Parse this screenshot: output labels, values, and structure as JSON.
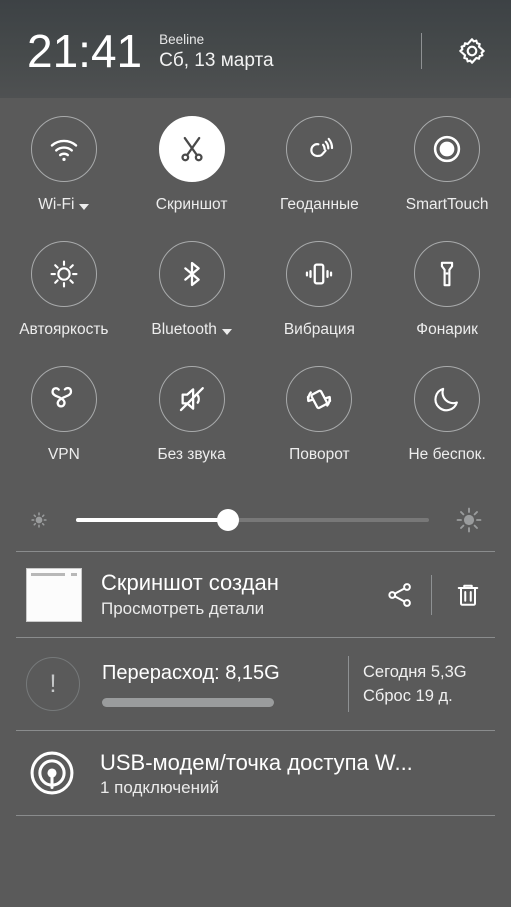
{
  "header": {
    "time": "21:41",
    "carrier": "Beeline",
    "date": "Сб, 13 марта",
    "settings_icon": "gear-icon"
  },
  "tiles": [
    [
      {
        "label": "Wi-Fi",
        "icon": "wifi-icon",
        "active": false,
        "caret": true
      },
      {
        "label": "Скриншот",
        "icon": "scissors-icon",
        "active": true,
        "caret": false
      },
      {
        "label": "Геоданные",
        "icon": "location-touch-icon",
        "active": false,
        "caret": false
      },
      {
        "label": "SmartTouch",
        "icon": "smarttouch-icon",
        "active": false,
        "caret": false
      }
    ],
    [
      {
        "label": "Автояркость",
        "icon": "brightness-auto-icon",
        "active": false,
        "caret": false
      },
      {
        "label": "Bluetooth",
        "icon": "bluetooth-icon",
        "active": false,
        "caret": true
      },
      {
        "label": "Вибрация",
        "icon": "vibration-icon",
        "active": false,
        "caret": false
      },
      {
        "label": "Фонарик",
        "icon": "flashlight-icon",
        "active": false,
        "caret": false
      }
    ],
    [
      {
        "label": "VPN",
        "icon": "vpn-key-icon",
        "active": false,
        "caret": false
      },
      {
        "label": "Без звука",
        "icon": "mute-icon",
        "active": false,
        "caret": false
      },
      {
        "label": "Поворот",
        "icon": "rotate-icon",
        "active": false,
        "caret": false
      },
      {
        "label": "Не беспок.",
        "icon": "moon-icon",
        "active": false,
        "caret": false
      }
    ]
  ],
  "brightness": {
    "value_percent": 43,
    "low_icon": "brightness-low-icon",
    "high_icon": "brightness-high-icon"
  },
  "notifications": {
    "screenshot": {
      "title": "Скриншот создан",
      "subtitle": "Просмотреть детали",
      "thumbnail_icon": "screenshot-thumbnail",
      "share_icon": "share-icon",
      "delete_icon": "trash-icon"
    },
    "data_usage": {
      "icon": "warning-circle-icon",
      "title": "Перерасход: 8,15G",
      "progress_percent": 100,
      "today": "Сегодня 5,3G",
      "reset": "Сброс 19 д."
    },
    "hotspot": {
      "icon": "hotspot-icon",
      "title": "USB-модем/точка доступа W...",
      "subtitle": "1 подключений"
    }
  },
  "colors": {
    "background": "#5a5a5a",
    "header_top": "#3d4245",
    "accent_active": "#ffffff",
    "text_primary": "#ffffff",
    "divider": "#8a8c8d"
  }
}
